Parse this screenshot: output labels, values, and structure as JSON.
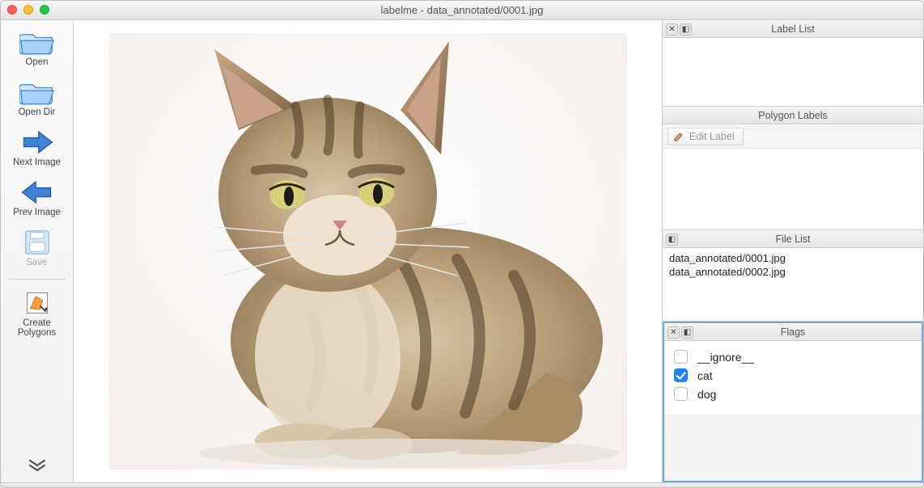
{
  "window": {
    "title": "labelme - data_annotated/0001.jpg"
  },
  "toolbar": {
    "open": "Open",
    "open_dir": "Open Dir",
    "next_image": "Next Image",
    "prev_image": "Prev Image",
    "save": "Save",
    "create_polygons": "Create\nPolygons"
  },
  "panels": {
    "label_list": {
      "title": "Label List"
    },
    "polygon_labels": {
      "title": "Polygon Labels",
      "edit_label": "Edit Label"
    },
    "file_list": {
      "title": "File List",
      "items": [
        "data_annotated/0001.jpg",
        "data_annotated/0002.jpg"
      ]
    },
    "flags": {
      "title": "Flags",
      "items": [
        {
          "label": "__ignore__",
          "checked": false
        },
        {
          "label": "cat",
          "checked": true
        },
        {
          "label": "dog",
          "checked": false
        }
      ]
    }
  }
}
